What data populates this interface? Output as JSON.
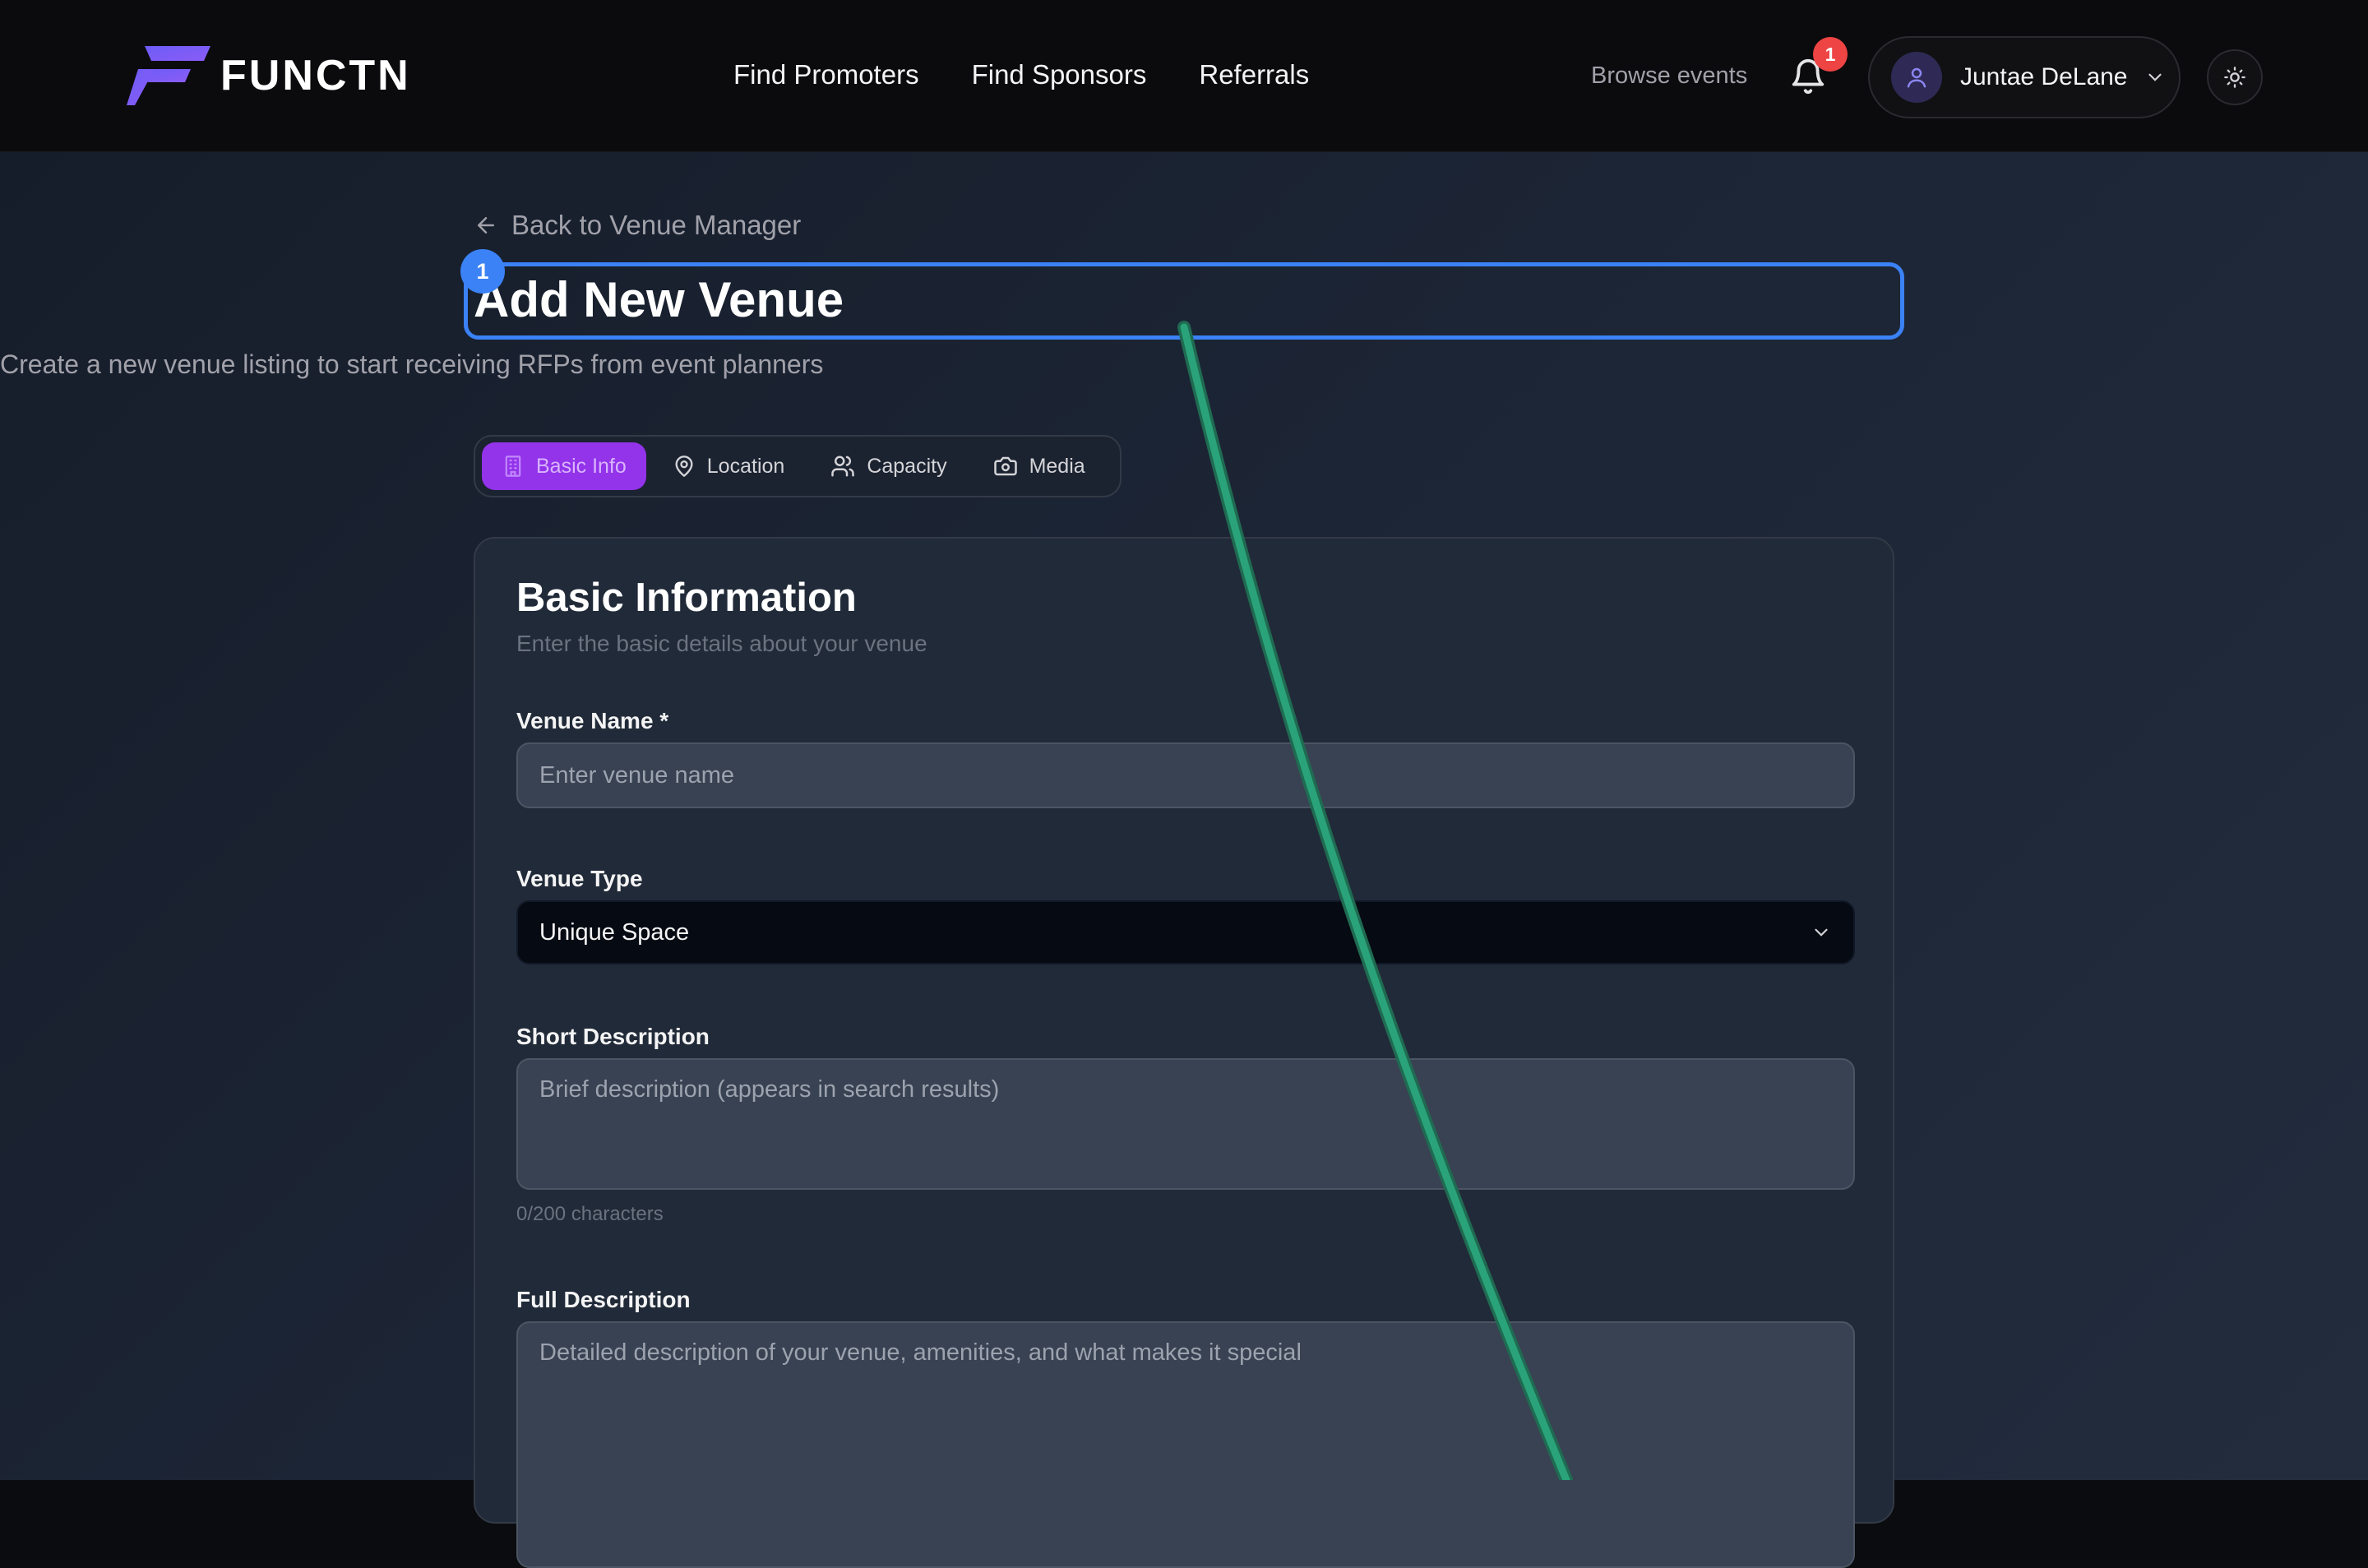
{
  "header": {
    "logo_text": "FUNCTN",
    "nav": [
      "Find Promoters",
      "Find Sponsors",
      "Referrals"
    ],
    "browse_events": "Browse events",
    "notifications_count": "1",
    "user_name": "Juntae DeLane"
  },
  "page": {
    "back_link": "Back to Venue Manager",
    "annotation_marker": "1",
    "title": "Add New Venue",
    "subtitle": "Create a new venue listing to start receiving RFPs from event planners"
  },
  "tabs": [
    {
      "label": "Basic Info",
      "icon": "building-icon",
      "active": true
    },
    {
      "label": "Location",
      "icon": "map-pin-icon",
      "active": false
    },
    {
      "label": "Capacity",
      "icon": "users-icon",
      "active": false
    },
    {
      "label": "Media",
      "icon": "camera-icon",
      "active": false
    }
  ],
  "form": {
    "section_title": "Basic Information",
    "section_subtitle": "Enter the basic details about your venue",
    "venue_name_label": "Venue Name *",
    "venue_name_placeholder": "Enter venue name",
    "venue_type_label": "Venue Type",
    "venue_type_value": "Unique Space",
    "short_desc_label": "Short Description",
    "short_desc_placeholder": "Brief description (appears in search results)",
    "short_desc_counter": "0/200 characters",
    "full_desc_label": "Full Description",
    "full_desc_placeholder": "Detailed description of your venue, amenities, and what makes it special"
  },
  "colors": {
    "accent": "#9333ea",
    "annotation": "#3b82f6",
    "badge": "#ef4444",
    "cursor_trail": "#2aa37a"
  }
}
